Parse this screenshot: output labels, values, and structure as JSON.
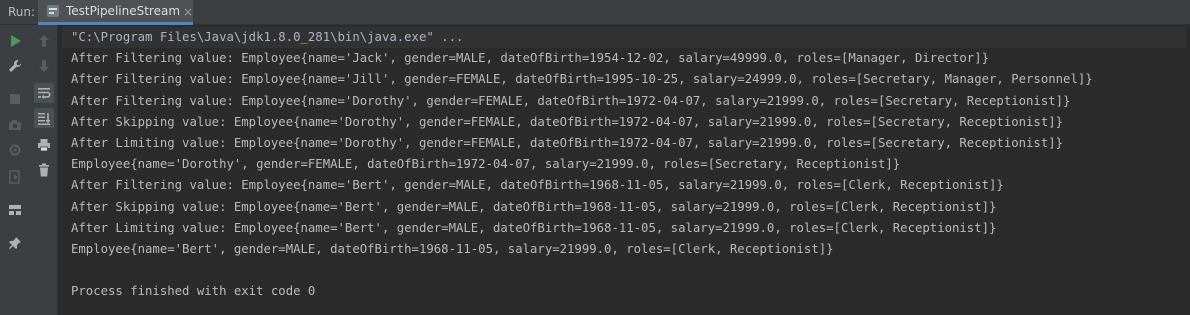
{
  "header": {
    "run_label": "Run:",
    "tab_title": "TestPipelineStream",
    "tab_close": "×"
  },
  "toolbar": {
    "left": [
      "run-icon",
      "wrench-icon",
      "stop-icon",
      "camera-icon",
      "exit-icon",
      "layout-icon",
      "pin-icon"
    ],
    "right": [
      "up-arrow-icon",
      "down-arrow-icon",
      "soft-wrap-icon",
      "scroll-to-end-icon",
      "print-icon",
      "trash-icon"
    ]
  },
  "console": {
    "command": "\"C:\\Program Files\\Java\\jdk1.8.0_281\\bin\\java.exe\" ...",
    "lines": [
      "After Filtering value: Employee{name='Jack', gender=MALE, dateOfBirth=1954-12-02, salary=49999.0, roles=[Manager, Director]}",
      "After Filtering value: Employee{name='Jill', gender=FEMALE, dateOfBirth=1995-10-25, salary=24999.0, roles=[Secretary, Manager, Personnel]}",
      "After Filtering value: Employee{name='Dorothy', gender=FEMALE, dateOfBirth=1972-04-07, salary=21999.0, roles=[Secretary, Receptionist]}",
      "After Skipping value: Employee{name='Dorothy', gender=FEMALE, dateOfBirth=1972-04-07, salary=21999.0, roles=[Secretary, Receptionist]}",
      "After Limiting value: Employee{name='Dorothy', gender=FEMALE, dateOfBirth=1972-04-07, salary=21999.0, roles=[Secretary, Receptionist]}",
      "Employee{name='Dorothy', gender=FEMALE, dateOfBirth=1972-04-07, salary=21999.0, roles=[Secretary, Receptionist]}",
      "After Filtering value: Employee{name='Bert', gender=MALE, dateOfBirth=1968-11-05, salary=21999.0, roles=[Clerk, Receptionist]}",
      "After Skipping value: Employee{name='Bert', gender=MALE, dateOfBirth=1968-11-05, salary=21999.0, roles=[Clerk, Receptionist]}",
      "After Limiting value: Employee{name='Bert', gender=MALE, dateOfBirth=1968-11-05, salary=21999.0, roles=[Clerk, Receptionist]}",
      "Employee{name='Bert', gender=MALE, dateOfBirth=1968-11-05, salary=21999.0, roles=[Clerk, Receptionist]}"
    ],
    "exit_message": "Process finished with exit code 0"
  },
  "colors": {
    "background": "#2b2b2b",
    "panel": "#3c3f41",
    "text": "#bbbbbb",
    "accent": "#4a88c7",
    "run_green": "#499c54"
  }
}
